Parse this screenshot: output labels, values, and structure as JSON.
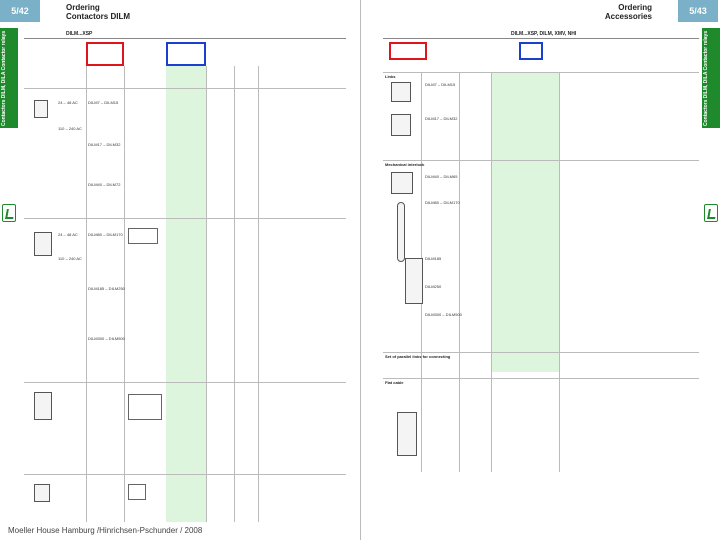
{
  "left": {
    "page_number": "5/42",
    "title": "Ordering",
    "subtitle": "Contactors DILM",
    "model_label": "DILM...XSP",
    "side_tab_label": "Contactors DILM, DILA Contactor relays",
    "row_texts": [
      "24 – 48 AC",
      "110 – 240 AC",
      "24 – 48 AC",
      "110 – 240 AC"
    ],
    "part_texts": [
      "DILM7 – DILM15",
      "DILM17 – DILM32",
      "DILM40 – DILM72",
      "DILM80 – DILM170",
      "DILM185 – DILM250",
      "DILM300 – DILM500"
    ],
    "footer": "Moeller House Hamburg /Hinrichsen-Pschunder / 2008"
  },
  "right": {
    "page_number": "5/43",
    "title": "Ordering",
    "subtitle": "Accessories",
    "model_label": "DILM...XSP, DILM, XMV, NHI",
    "side_tab_label": "Contactors DILM, DILA Contactor relays",
    "section_labels": [
      "Links",
      "Mechanical interlock",
      "Set of parallel links for connecting",
      "Flat cable"
    ],
    "part_texts": [
      "DILM7 – DILM15",
      "DILM17 – DILM32",
      "DILM40 – DILM65",
      "DILM80 – DILM170",
      "DILM185",
      "DILM250",
      "DILM300 – DILM500"
    ]
  },
  "colors": {
    "page_tab": "#7ab0c8",
    "side_tab": "#1f8a2b",
    "highlight_red": "#e0151b",
    "highlight_blue": "#1b3fcf",
    "column_green": "#dcf5dc"
  }
}
